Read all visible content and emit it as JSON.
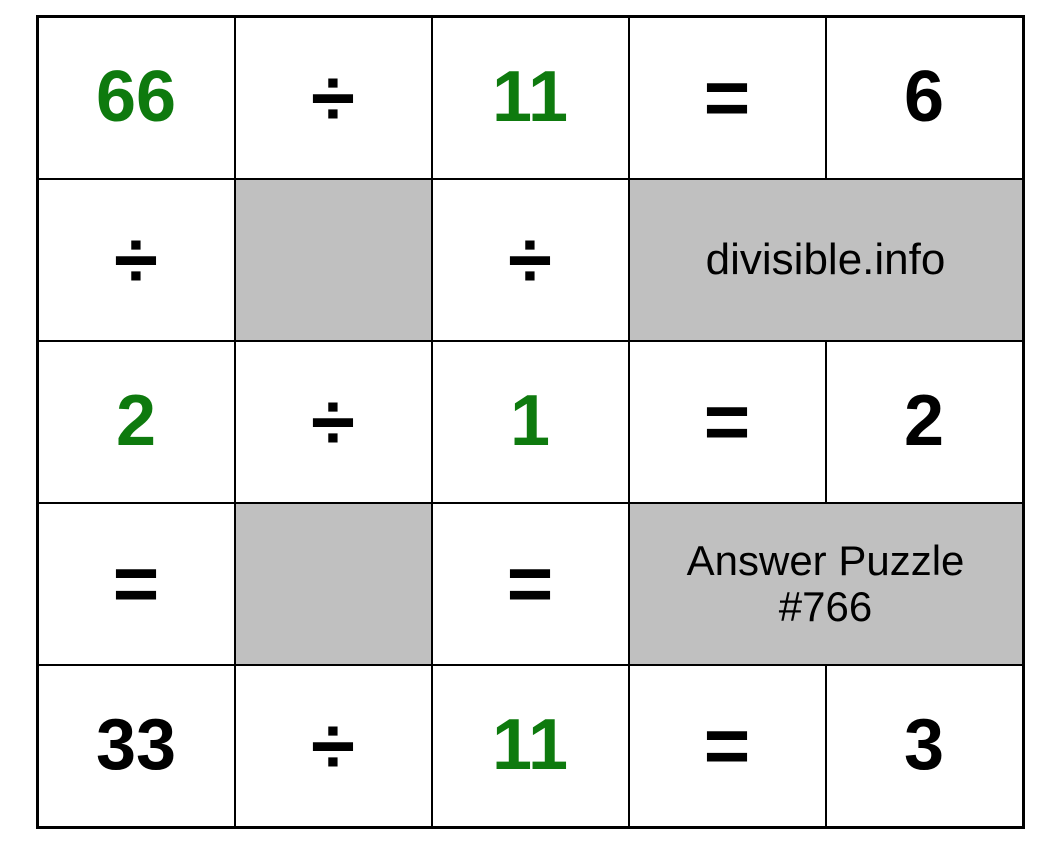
{
  "grid": {
    "r0c0": "66",
    "r0c1": "÷",
    "r0c2": "11",
    "r0c3": "=",
    "r0c4": "6",
    "r1c0": "÷",
    "r1c2": "÷",
    "r1info": "divisible.info",
    "r2c0": "2",
    "r2c1": "÷",
    "r2c2": "1",
    "r2c3": "=",
    "r2c4": "2",
    "r3c0": "=",
    "r3c2": "=",
    "r3info": "Answer Puzzle #766",
    "r4c0": "33",
    "r4c1": "÷",
    "r4c2": "11",
    "r4c3": "=",
    "r4c4": "3"
  },
  "colors": {
    "green": "#0e7a0e",
    "shaded": "#c0c0c0"
  },
  "chart_data": {
    "type": "table",
    "title": "Division Puzzle #766 Answer",
    "equations_horizontal": [
      {
        "a": 66,
        "op": "÷",
        "b": 11,
        "result": 6
      },
      {
        "a": 2,
        "op": "÷",
        "b": 1,
        "result": 2
      },
      {
        "a": 33,
        "op": "÷",
        "b": 11,
        "result": 3
      }
    ],
    "equations_vertical": [
      {
        "a": 66,
        "op": "÷",
        "b": 2,
        "result": 33
      },
      {
        "a": 11,
        "op": "÷",
        "b": 1,
        "result": 11
      }
    ],
    "highlighted_inputs": [
      66,
      11,
      2,
      1,
      11
    ],
    "source": "divisible.info",
    "puzzle_number": 766
  }
}
